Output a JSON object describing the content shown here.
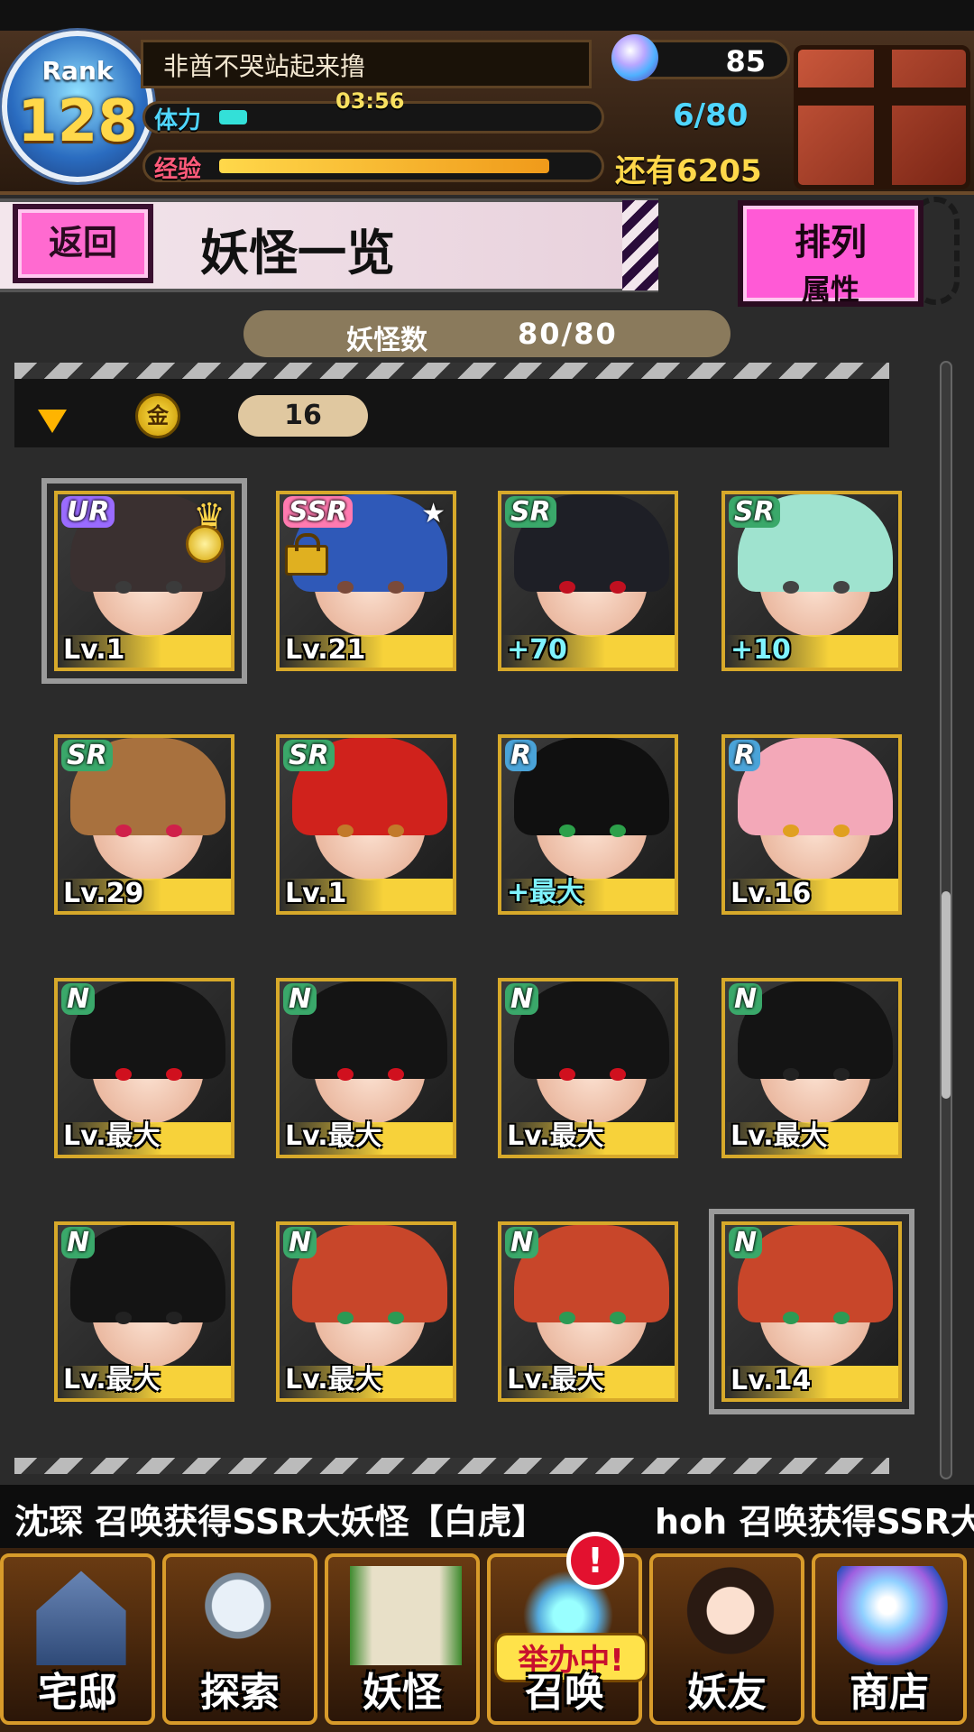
{
  "player": {
    "rank_label": "Rank",
    "rank": "128",
    "name": "非酋不哭站起来撸",
    "gems": "85",
    "stamina_label": "体力",
    "stamina_timer": "03:56",
    "stamina_count": "6/80",
    "stamina_fraction": 0.075,
    "exp_label": "经验",
    "exp_remaining": "还有6205",
    "exp_fraction": 0.88
  },
  "header": {
    "back_label": "返回",
    "title": "妖怪一览",
    "sort_label": "排列",
    "sort_value": "属性"
  },
  "count": {
    "label": "妖怪数",
    "value": "80/80"
  },
  "filter": {
    "coin_symbol": "金",
    "coin_value": "16"
  },
  "cards": [
    {
      "rarity": "UR",
      "level": "Lv.1",
      "hair": "#3a3030",
      "eye": "#3b3b3b",
      "crown": true,
      "selected": true
    },
    {
      "rarity": "SSR",
      "level": "Lv.21",
      "hair": "#2f59b8",
      "eye": "#7a4a3a",
      "star": true,
      "lock": true
    },
    {
      "rarity": "SR",
      "level": "+70",
      "hair": "#1e1f26",
      "eye": "#c01020"
    },
    {
      "rarity": "SR",
      "level": "+10",
      "hair": "#9fe3cf",
      "eye": "#444"
    },
    {
      "rarity": "SR",
      "level": "Lv.29",
      "hair": "#a8713e",
      "eye": "#d0204a"
    },
    {
      "rarity": "SR",
      "level": "Lv.1",
      "hair": "#d0221c",
      "eye": "#c27a2a"
    },
    {
      "rarity": "R",
      "level": "+最大",
      "hair": "#101010",
      "eye": "#2ca04a"
    },
    {
      "rarity": "R",
      "level": "Lv.16",
      "hair": "#f3a8b8",
      "eye": "#e0a020"
    },
    {
      "rarity": "N",
      "level": "Lv.最大",
      "hair": "#141414",
      "eye": "#d0101e"
    },
    {
      "rarity": "N",
      "level": "Lv.最大",
      "hair": "#141414",
      "eye": "#d0101e"
    },
    {
      "rarity": "N",
      "level": "Lv.最大",
      "hair": "#141414",
      "eye": "#d0101e"
    },
    {
      "rarity": "N",
      "level": "Lv.最大",
      "hair": "#141414",
      "eye": "#222"
    },
    {
      "rarity": "N",
      "level": "Lv.最大",
      "hair": "#141414",
      "eye": "#222"
    },
    {
      "rarity": "N",
      "level": "Lv.最大",
      "hair": "#c8462a",
      "eye": "#2c9a54"
    },
    {
      "rarity": "N",
      "level": "Lv.最大",
      "hair": "#c8462a",
      "eye": "#2c9a54"
    },
    {
      "rarity": "N",
      "level": "Lv.14",
      "hair": "#c8462a",
      "eye": "#2c9a54",
      "selected": true
    }
  ],
  "ticker": [
    "沈琛 召唤获得SSR大妖怪【白虎】",
    "hoh 召唤获得SSR大"
  ],
  "nav": [
    {
      "label": "宅邸",
      "icon": "house-icon"
    },
    {
      "label": "探索",
      "icon": "magnifier-map-icon"
    },
    {
      "label": "妖怪",
      "icon": "scroll-icon"
    },
    {
      "label": "召唤",
      "icon": "summon-star-icon",
      "badge": "举办中!"
    },
    {
      "label": "妖友",
      "icon": "friend-catgirl-icon"
    },
    {
      "label": "商店",
      "icon": "crystal-orb-icon"
    }
  ],
  "alert_symbol": "!",
  "colors": {
    "accent_pink": "#ff5ad6",
    "card_border_gold": "#d7a92a",
    "stamina_cyan": "#4fd6ff",
    "exp_gold": "#ffd84a"
  }
}
